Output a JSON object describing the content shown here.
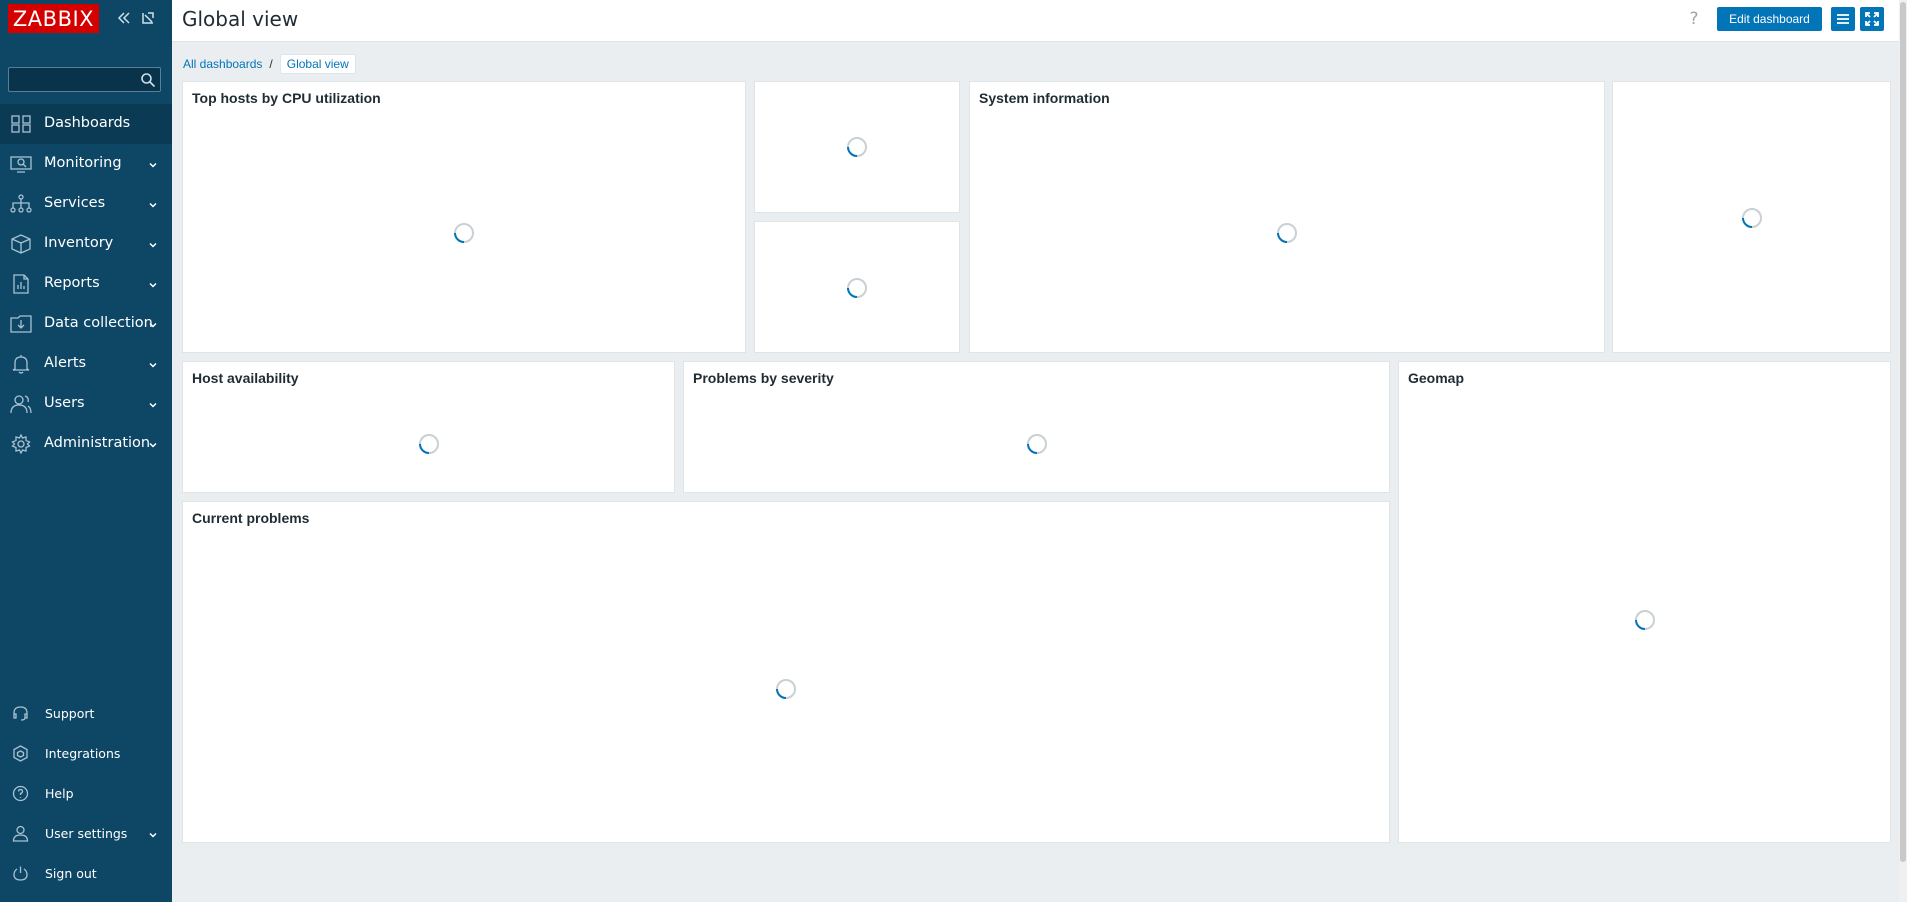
{
  "sidebar": {
    "logo": "ZABBIX",
    "search": {
      "value": "",
      "placeholder": ""
    },
    "menu": [
      {
        "label": "Dashboards",
        "icon": "dashboards-icon",
        "active": true
      },
      {
        "label": "Monitoring",
        "icon": "monitoring-icon"
      },
      {
        "label": "Services",
        "icon": "services-icon"
      },
      {
        "label": "Inventory",
        "icon": "inventory-icon"
      },
      {
        "label": "Reports",
        "icon": "reports-icon"
      },
      {
        "label": "Data collection",
        "icon": "data-collection-icon"
      },
      {
        "label": "Alerts",
        "icon": "alerts-icon"
      },
      {
        "label": "Users",
        "icon": "users-icon"
      },
      {
        "label": "Administration",
        "icon": "administration-icon"
      }
    ],
    "bottom_menu": [
      {
        "label": "Support",
        "icon": "support-icon"
      },
      {
        "label": "Integrations",
        "icon": "integrations-icon"
      },
      {
        "label": "Help",
        "icon": "help-icon"
      },
      {
        "label": "User settings",
        "icon": "user-settings-icon"
      },
      {
        "label": "Sign out",
        "icon": "sign-out-icon"
      }
    ]
  },
  "header": {
    "title": "Global view",
    "help_glyph": "?",
    "edit_dashboard_label": "Edit dashboard"
  },
  "breadcrumb": {
    "all_dashboards": "All dashboards",
    "separator": "/",
    "current": "Global view"
  },
  "widgets": {
    "top_hosts": {
      "title": "Top hosts by CPU utilization"
    },
    "system_information": {
      "title": "System information"
    },
    "host_availability": {
      "title": "Host availability"
    },
    "problems_by_severity": {
      "title": "Problems by severity"
    },
    "geomap": {
      "title": "Geomap"
    },
    "current_problems": {
      "title": "Current problems"
    }
  },
  "colors": {
    "sidebar_bg": "#0e4766",
    "logo_bg": "#d40000",
    "accent": "#0275b8",
    "page_bg": "#ebeef0"
  }
}
